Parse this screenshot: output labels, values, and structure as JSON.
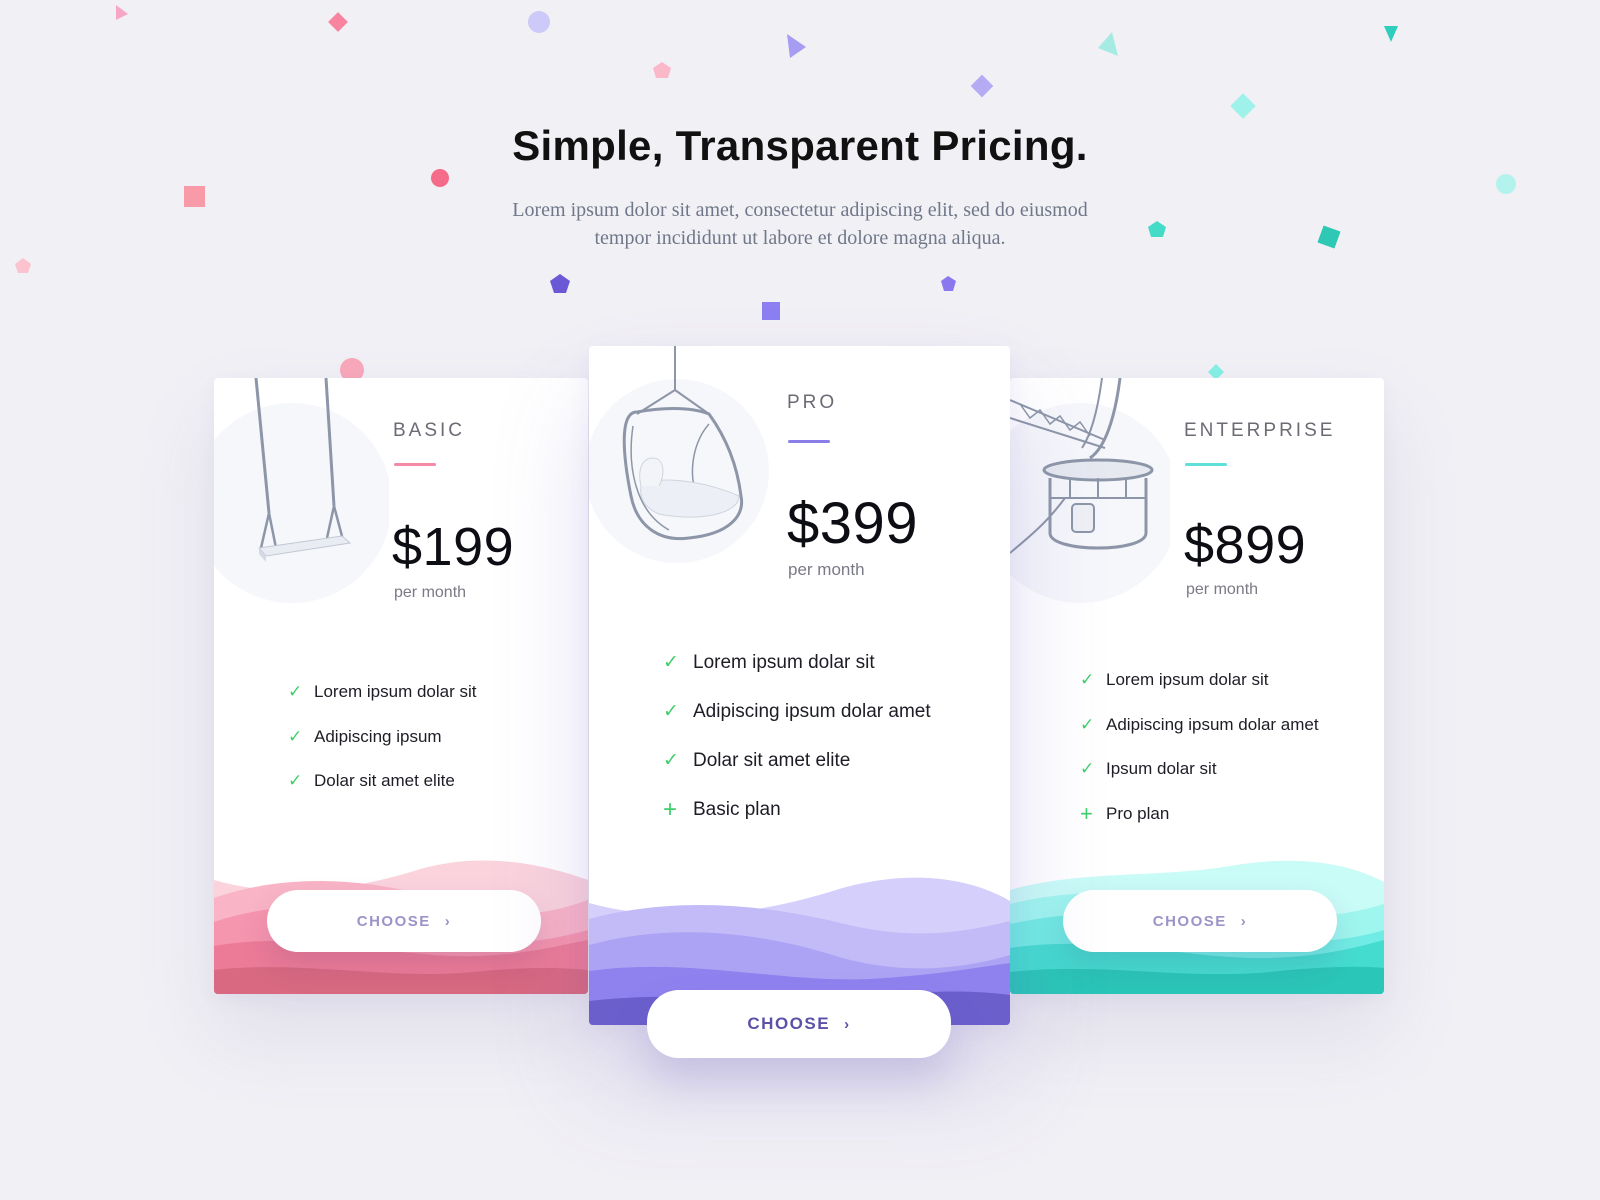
{
  "header": {
    "title": "Simple, Transparent Pricing.",
    "subtitle_line1": "Lorem ipsum dolor sit amet, consectetur adipiscing elit, sed do eiusmod",
    "subtitle_line2": "tempor incididunt ut labore et dolore magna aliqua."
  },
  "plans": [
    {
      "name": "BASIC",
      "price": "$199",
      "period": "per month",
      "accent": "#f48aa6",
      "illustration": "swing-icon",
      "features": [
        {
          "mark": "check",
          "text": "Lorem ipsum dolar sit"
        },
        {
          "mark": "check",
          "text": "Adipiscing ipsum"
        },
        {
          "mark": "check",
          "text": "Dolar sit amet elite"
        }
      ],
      "button": "CHOOSE"
    },
    {
      "name": "PRO",
      "price": "$399",
      "period": "per month",
      "accent": "#8b7ee8",
      "illustration": "hanging-chair-icon",
      "features": [
        {
          "mark": "check",
          "text": "Lorem ipsum dolar sit"
        },
        {
          "mark": "check",
          "text": "Adipiscing ipsum dolar amet"
        },
        {
          "mark": "check",
          "text": "Dolar sit amet elite"
        },
        {
          "mark": "plus",
          "text": "Basic plan"
        }
      ],
      "button": "CHOOSE"
    },
    {
      "name": "ENTERPRISE",
      "price": "$899",
      "period": "per month",
      "accent": "#5fe0d8",
      "illustration": "ferris-wheel-cabin-icon",
      "features": [
        {
          "mark": "check",
          "text": "Lorem ipsum dolar sit"
        },
        {
          "mark": "check",
          "text": "Adipiscing ipsum dolar amet"
        },
        {
          "mark": "check",
          "text": "Ipsum dolar sit"
        },
        {
          "mark": "plus",
          "text": "Pro plan"
        }
      ],
      "button": "CHOOSE"
    }
  ],
  "icons": {
    "check": "✓",
    "plus": "+",
    "chevron": "›"
  },
  "colors": {
    "background": "#f1f0f5",
    "check_green": "#3fcf6a",
    "basic_wave": "#f06a8c",
    "pro_wave": "#7a6ae8",
    "enterprise_wave": "#38d6c8"
  }
}
